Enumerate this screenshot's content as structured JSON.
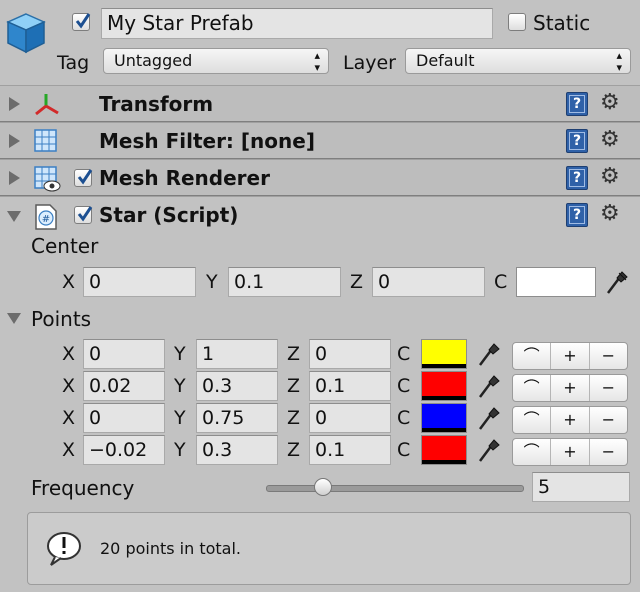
{
  "object": {
    "name": "My Star Prefab",
    "active": true,
    "static_label": "Static",
    "static_checked": false,
    "tag_label": "Tag",
    "tag_value": "Untagged",
    "layer_label": "Layer",
    "layer_value": "Default"
  },
  "components": [
    {
      "title": "Transform",
      "icon": "transform-axes-icon"
    },
    {
      "title": "Mesh Filter: [none]",
      "icon": "mesh-filter-icon"
    },
    {
      "title": "Mesh Renderer",
      "icon": "mesh-renderer-icon",
      "enabled": true
    },
    {
      "title": "Star (Script)",
      "icon": "csharp-script-icon",
      "enabled": true
    }
  ],
  "script": {
    "center_label": "Center",
    "center": {
      "x": "0",
      "y": "0.1",
      "z": "0",
      "color": "#ffffff"
    },
    "points_label": "Points",
    "points": [
      {
        "x": "0",
        "y": "1",
        "z": "0",
        "color": "#ffff00"
      },
      {
        "x": "0.02",
        "y": "0.3",
        "z": "0.1",
        "color": "#ff0000"
      },
      {
        "x": "0",
        "y": "0.75",
        "z": "0",
        "color": "#0000ff"
      },
      {
        "x": "−0.02",
        "y": "0.3",
        "z": "0.1",
        "color": "#ff0000"
      }
    ],
    "axis_labels": {
      "x": "X",
      "y": "Y",
      "z": "Z",
      "c": "C"
    },
    "row_buttons": [
      "⌒",
      "+",
      "−"
    ],
    "frequency_label": "Frequency",
    "frequency_value": "5",
    "frequency_fraction": 0.2,
    "help_message": "20 points in total."
  },
  "colors": {
    "header_bg": "#bdbdbd",
    "panel_bg": "#c2c2c2",
    "help_icon": "#2f61a8"
  }
}
